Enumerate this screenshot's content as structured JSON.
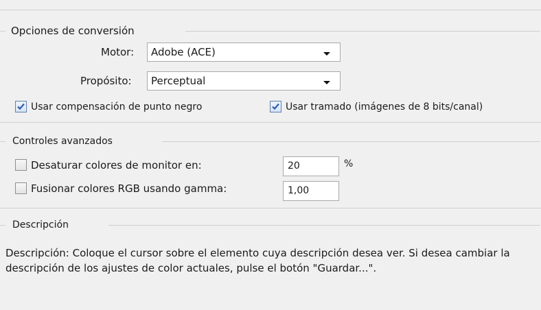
{
  "conversion": {
    "group_title": "Opciones de conversión",
    "engine_label": "Motor:",
    "engine_value": "Adobe (ACE)",
    "intent_label": "Propósito:",
    "intent_value": "Perceptual",
    "black_point_label": "Usar compensación de punto negro",
    "black_point_checked": true,
    "dither_label": "Usar tramado (imágenes de 8 bits/canal)",
    "dither_checked": true
  },
  "advanced": {
    "group_title": "Controles avanzados",
    "desaturate_label": "Desaturar colores de monitor en:",
    "desaturate_checked": false,
    "desaturate_value": "20",
    "desaturate_unit": "%",
    "blend_label": "Fusionar colores RGB usando gamma:",
    "blend_checked": false,
    "blend_value": "1,00"
  },
  "description": {
    "group_title": "Descripción",
    "text": "Descripción: Coloque el cursor sobre el elemento cuya descripción desea ver. Si desea cambiar la descripción de los ajustes de color actuales, pulse el botón \"Guardar...\"."
  },
  "icons": {
    "checkmark": "checkmark-icon",
    "dropdown": "chevron-down-icon"
  },
  "colors": {
    "panel_bg": "#f0f0f0",
    "check_blue": "#2a5db0"
  }
}
